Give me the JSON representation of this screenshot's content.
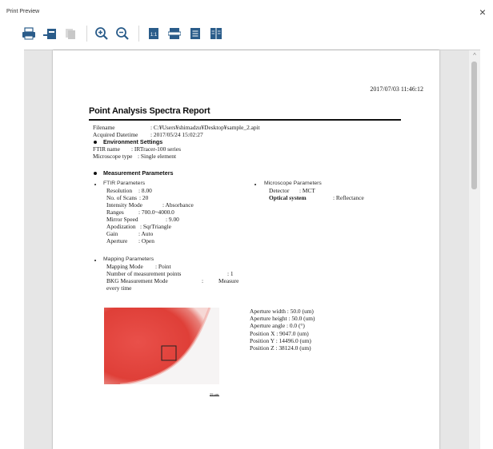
{
  "window": {
    "title": "Print Preview",
    "close_symbol": "×"
  },
  "toolbar": {
    "buttons": [
      {
        "icon": "printer-icon"
      },
      {
        "icon": "export-icon"
      },
      {
        "icon": "copy-icon"
      },
      {
        "icon": "zoom-in-icon"
      },
      {
        "icon": "zoom-out-icon"
      },
      {
        "icon": "actual-size-icon"
      },
      {
        "icon": "fit-width-icon"
      },
      {
        "icon": "single-page-icon"
      },
      {
        "icon": "two-page-icon"
      }
    ]
  },
  "report": {
    "print_datetime": "2017/07/03 11:46:12",
    "title": "Point Analysis Spectra Report",
    "filename_label": "Filename",
    "filename_value": ": C:¥Users¥shimadzu¥Desktop¥sample_2.apit",
    "acquired_label": "Acquired Datetime",
    "acquired_value": ": 2017/05/24 15:02:27",
    "env_heading": "Environment Settings",
    "ftir_name_label": "FTIR name",
    "ftir_name_value": ": IRTracer-100 series",
    "microscope_type_label": "Microscope type",
    "microscope_type_value": ": Single element",
    "meas_heading": "Measurement Parameters",
    "ftir_params_heading": "FTIR Parameters",
    "resolution_label": "Resolution",
    "resolution_value": ": 8.00",
    "scans_label": "No. of Scans",
    "scans_value": ": 20",
    "intensity_label": "Intensity Mode",
    "intensity_value": ": Absorbance",
    "ranges_label": "Ranges",
    "ranges_value": ": 700.0~4000.0",
    "mirror_label": "Mirror Speed",
    "mirror_value": ": 9.00",
    "apod_label": "Apodization",
    "apod_value": ": SqrTriangle",
    "gain_label": "Gain",
    "gain_value": ": Auto",
    "aperture_label": "Aperture",
    "aperture_value": ": Open",
    "mapping_heading": "Mapping Parameters",
    "mapping_mode_label": "Mapping Mode",
    "mapping_mode_value": ": Point",
    "num_points_label": "Number of measurement points",
    "num_points_value": ": 1",
    "bkg_label": "BKG Measurement Mode",
    "bkg_colon": ":",
    "bkg_value": "Measure",
    "bkg_value_cont": "every time",
    "micro_params_heading": "Microscope Parameters",
    "detector_label": "Detector",
    "detector_value": ": MCT",
    "optical_label": "Optical system",
    "optical_value": ": Reflectance",
    "aperture_width": "Aperture width : 50.0   (um)",
    "aperture_height": "Aperture height : 50.0   (um)",
    "aperture_angle": "Aperture angle : 0.0   (°)",
    "position_x": "Position X : 9047.0   (um)",
    "position_y": "Position Y : 14496.0   (um)",
    "position_z": "Position Z : 38124.0   (um)",
    "scale_label": "25 μm"
  },
  "colors": {
    "sample_red": "#e0433b",
    "sample_pink": "#f2a6a0",
    "printer_blue": "#2a5c8a"
  }
}
